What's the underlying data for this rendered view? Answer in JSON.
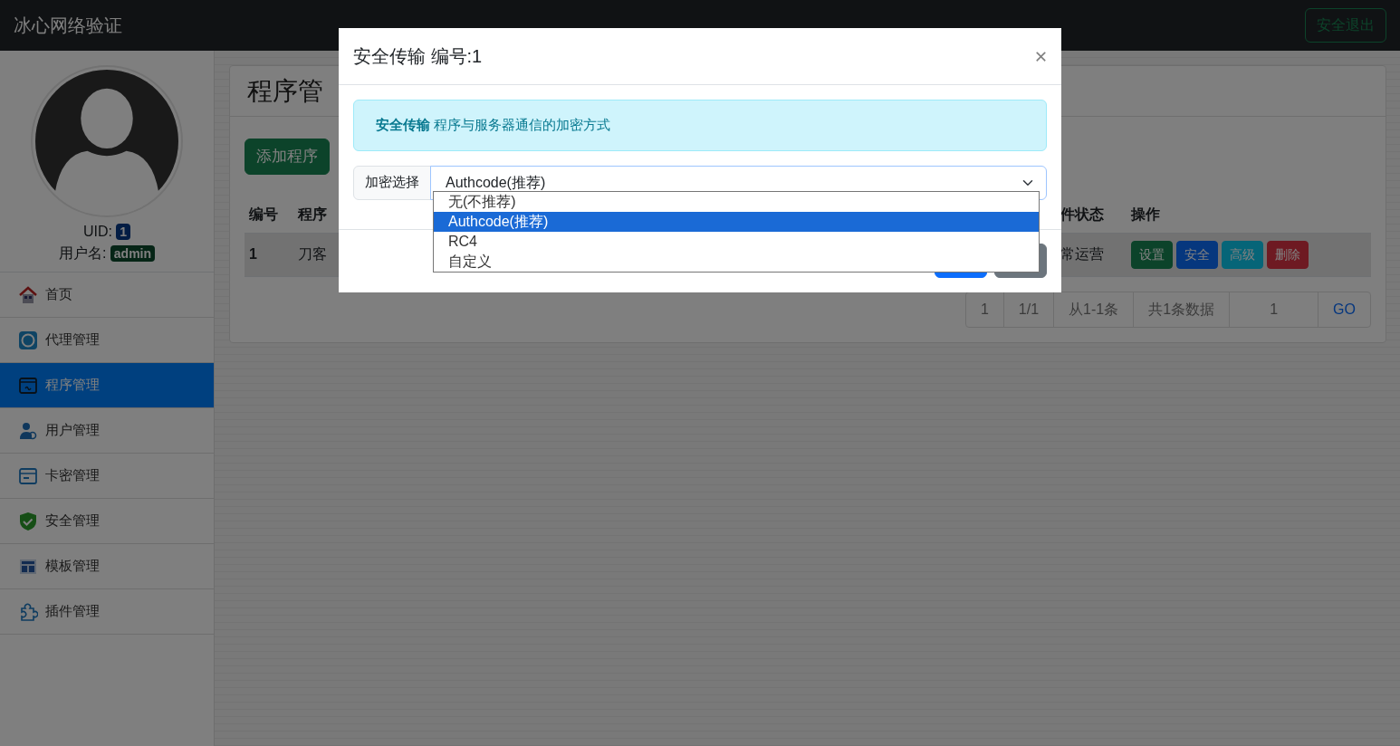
{
  "navbar": {
    "brand": "冰心网络验证",
    "logout_button": "安全退出"
  },
  "sidebar": {
    "uid_label": "UID:",
    "uid": "1",
    "username_label": "用户名:",
    "username": "admin",
    "items": [
      {
        "label": "首页",
        "selected": false
      },
      {
        "label": "代理管理",
        "selected": false
      },
      {
        "label": "程序管理",
        "selected": true
      },
      {
        "label": "用户管理",
        "selected": false
      },
      {
        "label": "卡密管理",
        "selected": false
      },
      {
        "label": "安全管理",
        "selected": false
      },
      {
        "label": "模板管理",
        "selected": false
      },
      {
        "label": "插件管理",
        "selected": false
      }
    ]
  },
  "page": {
    "title": "程序管",
    "add_button": "添加程序",
    "table": {
      "columns": [
        "编号",
        "程序",
        "件状态",
        "操作"
      ],
      "rows": [
        {
          "cells": [
            "1",
            "刀客",
            "常运营"
          ],
          "actions": [
            {
              "label": "设置",
              "kind": "success"
            },
            {
              "label": "安全",
              "kind": "primary"
            },
            {
              "label": "高级",
              "kind": "info"
            },
            {
              "label": "删除",
              "kind": "danger"
            }
          ]
        }
      ]
    },
    "pagination": {
      "items": [
        "1",
        "1/1",
        "从1-1条",
        "共1条数据"
      ],
      "page_value": "1",
      "go_button": "GO"
    }
  },
  "modal": {
    "title": "安全传输 编号:1",
    "alert": "**安全传输** 程序与服务器通信的加密方式",
    "select_label": "加密选择",
    "select_value": "Authcode(推荐)",
    "options": [
      {
        "label": "无(不推荐)",
        "selected": false
      },
      {
        "label": "Authcode(推荐)",
        "selected": true
      },
      {
        "label": "RC4",
        "selected": false
      },
      {
        "label": "自定义",
        "selected": false
      }
    ]
  }
}
